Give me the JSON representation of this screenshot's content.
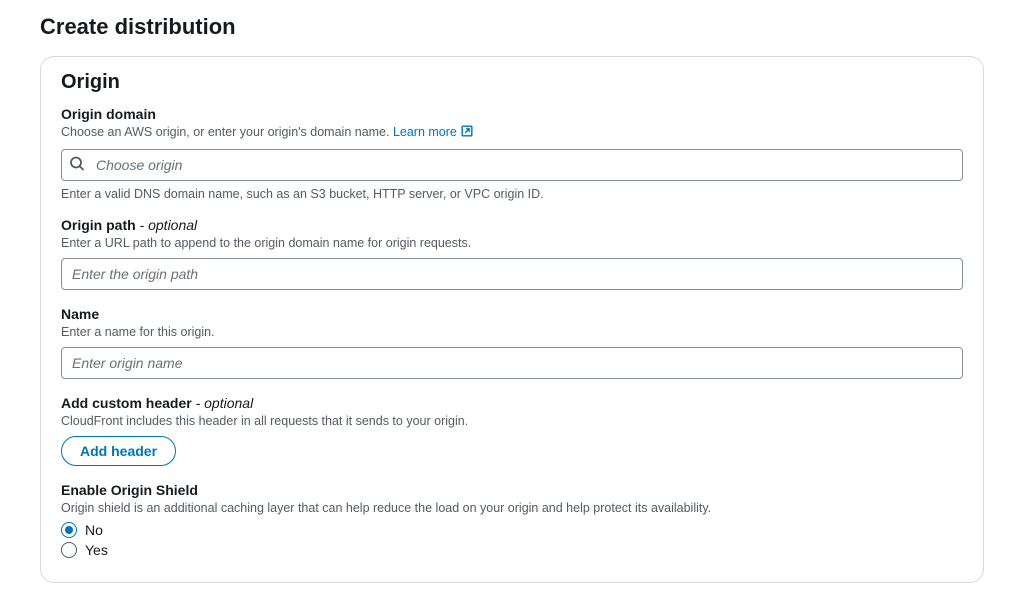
{
  "page": {
    "title": "Create distribution"
  },
  "panel": {
    "title": "Origin"
  },
  "origin_domain": {
    "label": "Origin domain",
    "desc_prefix": "Choose an AWS origin, or enter your origin's domain name. ",
    "learn_more": "Learn more",
    "placeholder": "Choose origin",
    "hint": "Enter a valid DNS domain name, such as an S3 bucket, HTTP server, or VPC origin ID."
  },
  "origin_path": {
    "label": "Origin path",
    "optional": " - optional",
    "desc": "Enter a URL path to append to the origin domain name for origin requests.",
    "placeholder": "Enter the origin path"
  },
  "name": {
    "label": "Name",
    "desc": "Enter a name for this origin.",
    "placeholder": "Enter origin name"
  },
  "custom_header": {
    "label": "Add custom header",
    "optional": " - optional",
    "desc": "CloudFront includes this header in all requests that it sends to your origin.",
    "button": "Add header"
  },
  "origin_shield": {
    "label": "Enable Origin Shield",
    "desc": "Origin shield is an additional caching layer that can help reduce the load on your origin and help protect its availability.",
    "options": {
      "no": "No",
      "yes": "Yes"
    },
    "selected": "no"
  }
}
